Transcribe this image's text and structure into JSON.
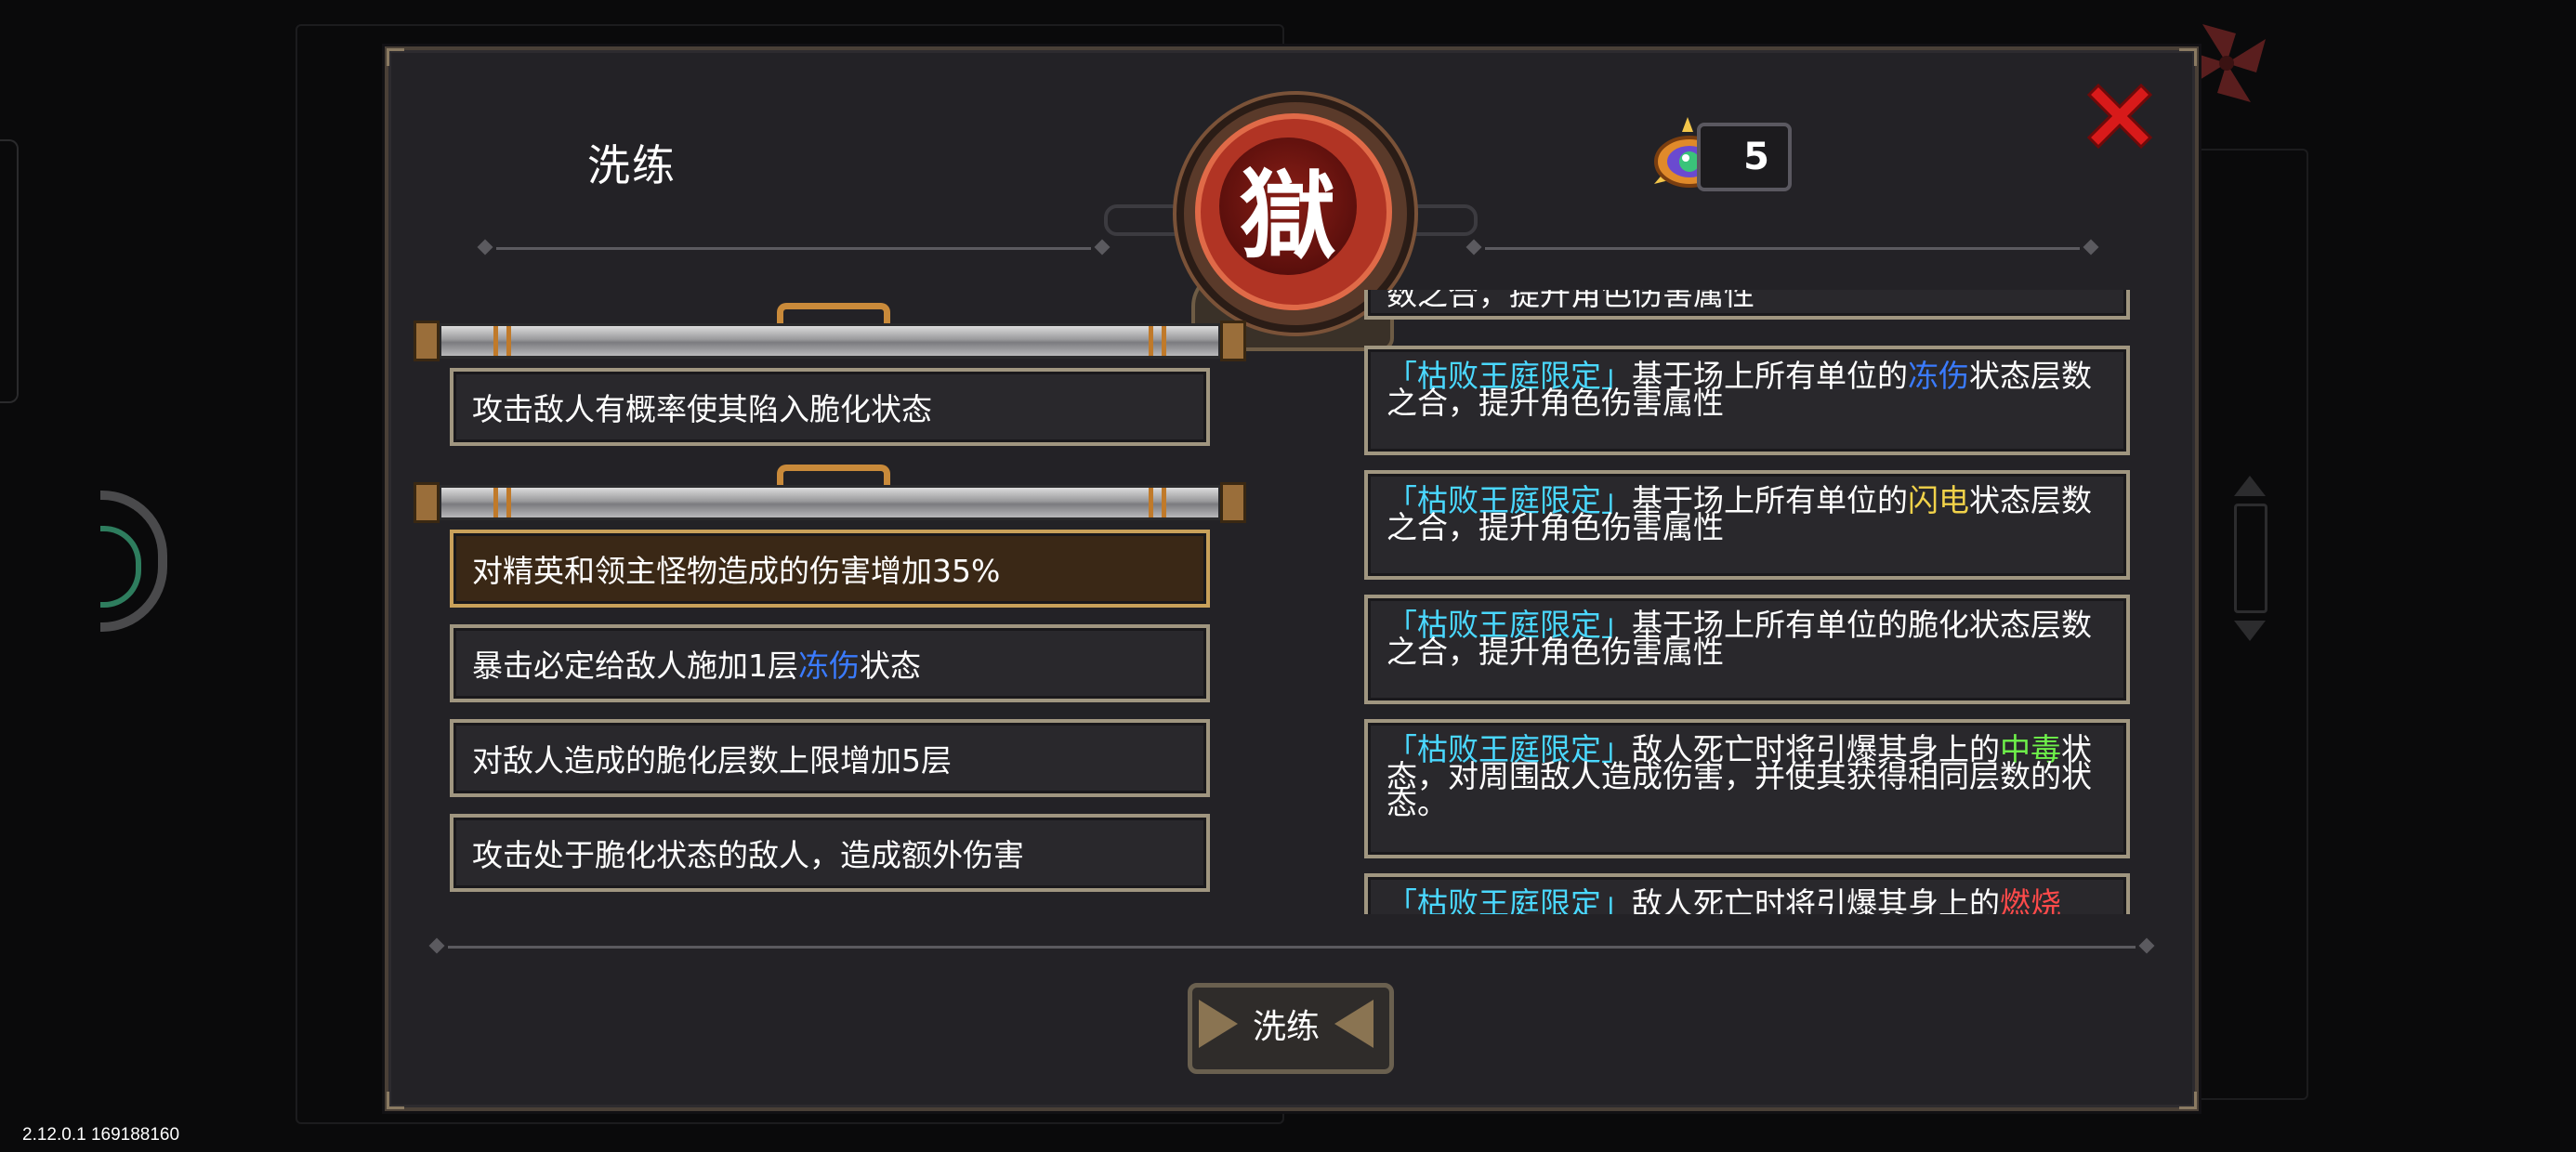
{
  "version_text": "2.12.0.1 169188160",
  "panel": {
    "title": "洗练",
    "emblem_char": "獄"
  },
  "currency": {
    "icon": "eye-gem-icon",
    "count": "5"
  },
  "close_icon": "close-x-icon",
  "left_options": [
    {
      "text": "攻击敌人有概率使其陷入脆化状态",
      "selected": false
    },
    {
      "text": "对精英和领主怪物造成的伤害增加35%",
      "selected": true
    },
    {
      "pre": "暴击必定给敌人施加1层",
      "highlight": "冻伤",
      "post": "状态",
      "selected": false
    },
    {
      "text": "对敌人造成的脆化层数上限增加5层",
      "selected": false
    },
    {
      "text": "攻击处于脆化状态的敌人，造成额外伤害",
      "selected": false
    }
  ],
  "right_cards": [
    {
      "tag": "",
      "pre": "数之合，提升角色伤害属性",
      "highlight": "",
      "post": ""
    },
    {
      "tag": "「枯败王庭限定」",
      "pre": "基于场上所有单位的",
      "highlight": "冻伤",
      "post": "状态层数之合，提升角色伤害属性"
    },
    {
      "tag": "「枯败王庭限定」",
      "pre": "基于场上所有单位的",
      "highlight": "闪电",
      "post": "状态层数之合，提升角色伤害属性"
    },
    {
      "tag": "「枯败王庭限定」",
      "pre": "基于场上所有单位的脆化状态层数之合，提升角色伤害属性",
      "highlight": "",
      "post": ""
    },
    {
      "tag": "「枯败王庭限定」",
      "pre": "敌人死亡时将引爆其身上的",
      "highlight": "中毒",
      "post": "状态，对周围敌人造成伤害，并使其获得相同层数的状态。"
    },
    {
      "tag": "「枯败王庭限定」",
      "pre": "敌人死亡时将引爆其身上的",
      "highlight": "燃烧",
      "post": ""
    }
  ],
  "colors": {
    "tag": "#4ad8ff",
    "frost": "#3a7bff",
    "lightning": "#f1d24a",
    "poison": "#6ef04a",
    "burn": "#ff4a4a",
    "selected_border": "#c9a15a"
  },
  "refine_button": {
    "label": "洗练"
  }
}
